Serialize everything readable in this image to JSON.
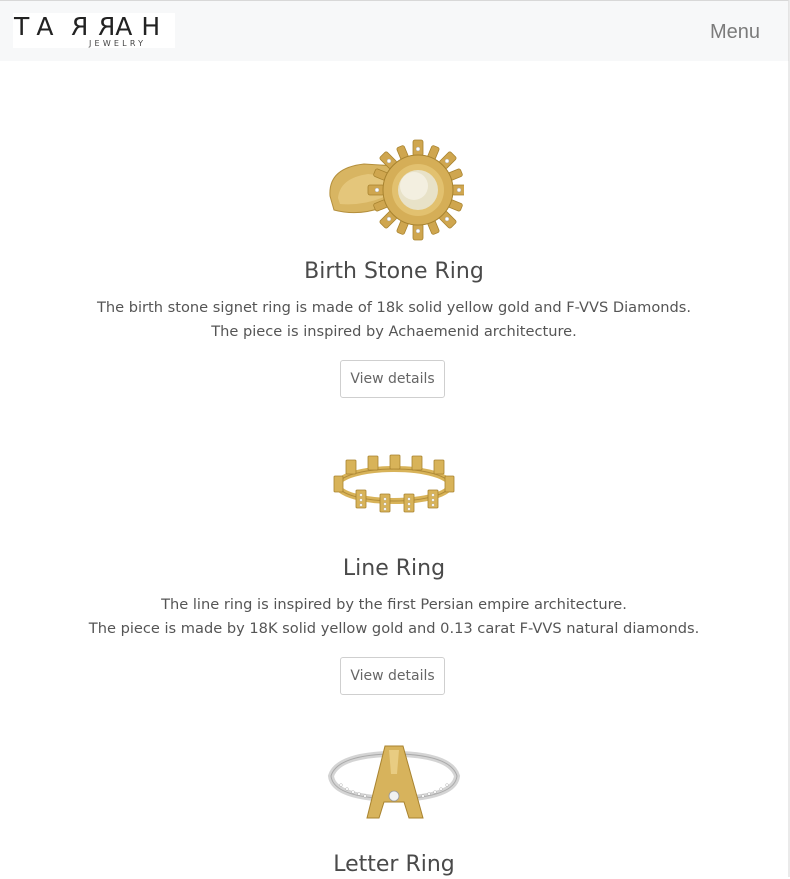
{
  "header": {
    "logo_main": "TARRAH",
    "logo_sub": "JEWELRY",
    "menu_label": "Menu"
  },
  "products": [
    {
      "title": "Birth Stone Ring",
      "desc_line1": "The birth stone signet ring is made of 18k solid yellow gold and F-VVS Diamonds.",
      "desc_line2": "The piece is inspired by Achaemenid architecture.",
      "button": "View details"
    },
    {
      "title": "Line Ring",
      "desc_line1": "The line ring is inspired by the first Persian empire architecture.",
      "desc_line2": "The piece is made by 18K solid yellow gold and 0.13 carat F-VVS natural diamonds.",
      "button": "View details"
    },
    {
      "title": "Letter Ring",
      "letter": "A"
    }
  ],
  "colors": {
    "gold": "#d9b65f",
    "gold_dark": "#b8943f",
    "silver": "#d6d6d6"
  }
}
